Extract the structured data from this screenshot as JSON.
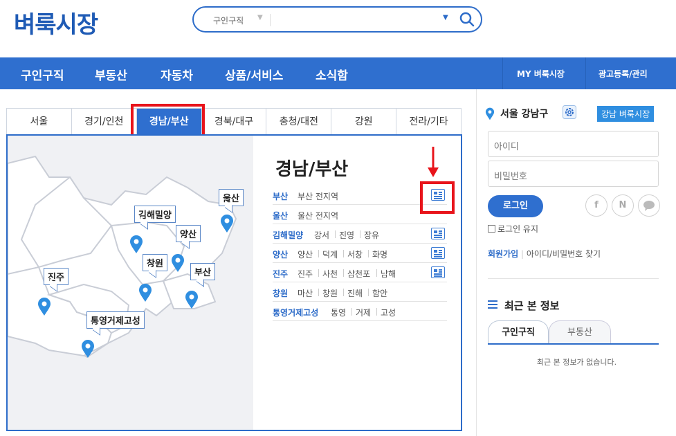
{
  "header": {
    "logo": "벼룩시장",
    "search_category": "구인구직",
    "search_placeholder": ""
  },
  "nav": {
    "items": [
      "구인구직",
      "부동산",
      "자동차",
      "상품/서비스",
      "소식함"
    ],
    "right": [
      "MY 벼룩시장",
      "광고등록/관리"
    ]
  },
  "regions": {
    "tabs": [
      "서울",
      "경기/인천",
      "경남/부산",
      "경북/대구",
      "충청/대전",
      "강원",
      "전라/기타"
    ],
    "active": "경남/부산",
    "title": "경남/부산",
    "map_labels": [
      "울산",
      "김해밀양",
      "양산",
      "창원",
      "부산",
      "진주",
      "통영거제고성"
    ],
    "rows": [
      {
        "name": "부산",
        "subs": [
          "부산 전지역"
        ],
        "icon": true
      },
      {
        "name": "울산",
        "subs": [
          "울산 전지역"
        ],
        "icon": false
      },
      {
        "name": "김해밀양",
        "subs": [
          "강서",
          "진영",
          "장유"
        ],
        "icon": true
      },
      {
        "name": "양산",
        "subs": [
          "양산",
          "덕계",
          "서창",
          "화명"
        ],
        "icon": true
      },
      {
        "name": "진주",
        "subs": [
          "진주",
          "사천",
          "삼천포",
          "남해"
        ],
        "icon": true
      },
      {
        "name": "창원",
        "subs": [
          "마산",
          "창원",
          "진해",
          "함안"
        ],
        "icon": false
      },
      {
        "name": "통영거제고성",
        "subs": [
          "통영",
          "거제",
          "고성"
        ],
        "icon": false
      }
    ]
  },
  "sidebar": {
    "location": "서울 강남구",
    "location_badge": "강남 벼룩시장",
    "id_placeholder": "아이디",
    "pw_placeholder": "비밀번호",
    "login": "로그인",
    "social": [
      "f",
      "N",
      "talk"
    ],
    "keep_login": "로그인 유지",
    "join": "회원가입",
    "find": "아이디/비밀번호 찾기",
    "recent_title": "최근 본 정보",
    "recent_tabs": [
      "구인구직",
      "부동산"
    ],
    "empty": "최근 본 정보가 없습니다."
  },
  "colors": {
    "brand": "#2f6fcf",
    "highlight": "#e8141b"
  }
}
